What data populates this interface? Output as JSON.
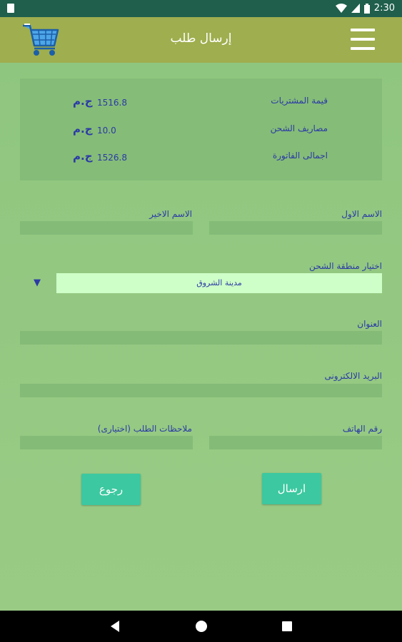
{
  "status_bar": {
    "time": "2:30"
  },
  "app_bar": {
    "title": "إرسال طلب"
  },
  "summary": {
    "rows": [
      {
        "label": "قيمة المشتريات",
        "value": "1516.8",
        "currency": "ج.م"
      },
      {
        "label": "مصاريف الشحن",
        "value": "10.0",
        "currency": "ج.م"
      },
      {
        "label": "اجمالى الفاتورة",
        "value": "1526.8",
        "currency": "ج.م"
      }
    ]
  },
  "form": {
    "first_name_label": "الاسم الاول",
    "last_name_label": "الاسم الاخير",
    "region_label": "اختيار منطقة الشحن",
    "region_selected": "مدينة الشروق",
    "address_label": "العنوان",
    "email_label": "البريد الالكترونى",
    "phone_label": "رقم الهاتف",
    "notes_label": "ملاحظات الطلب (اختيارى)"
  },
  "buttons": {
    "send": "ارسال",
    "back": "رجوع"
  },
  "colors": {
    "background": "#8fc67f",
    "app_bar": "#9fae4e",
    "status_bar": "#1f5f4c",
    "button": "#3cc8a0",
    "label_text": "#2b3aa6"
  }
}
